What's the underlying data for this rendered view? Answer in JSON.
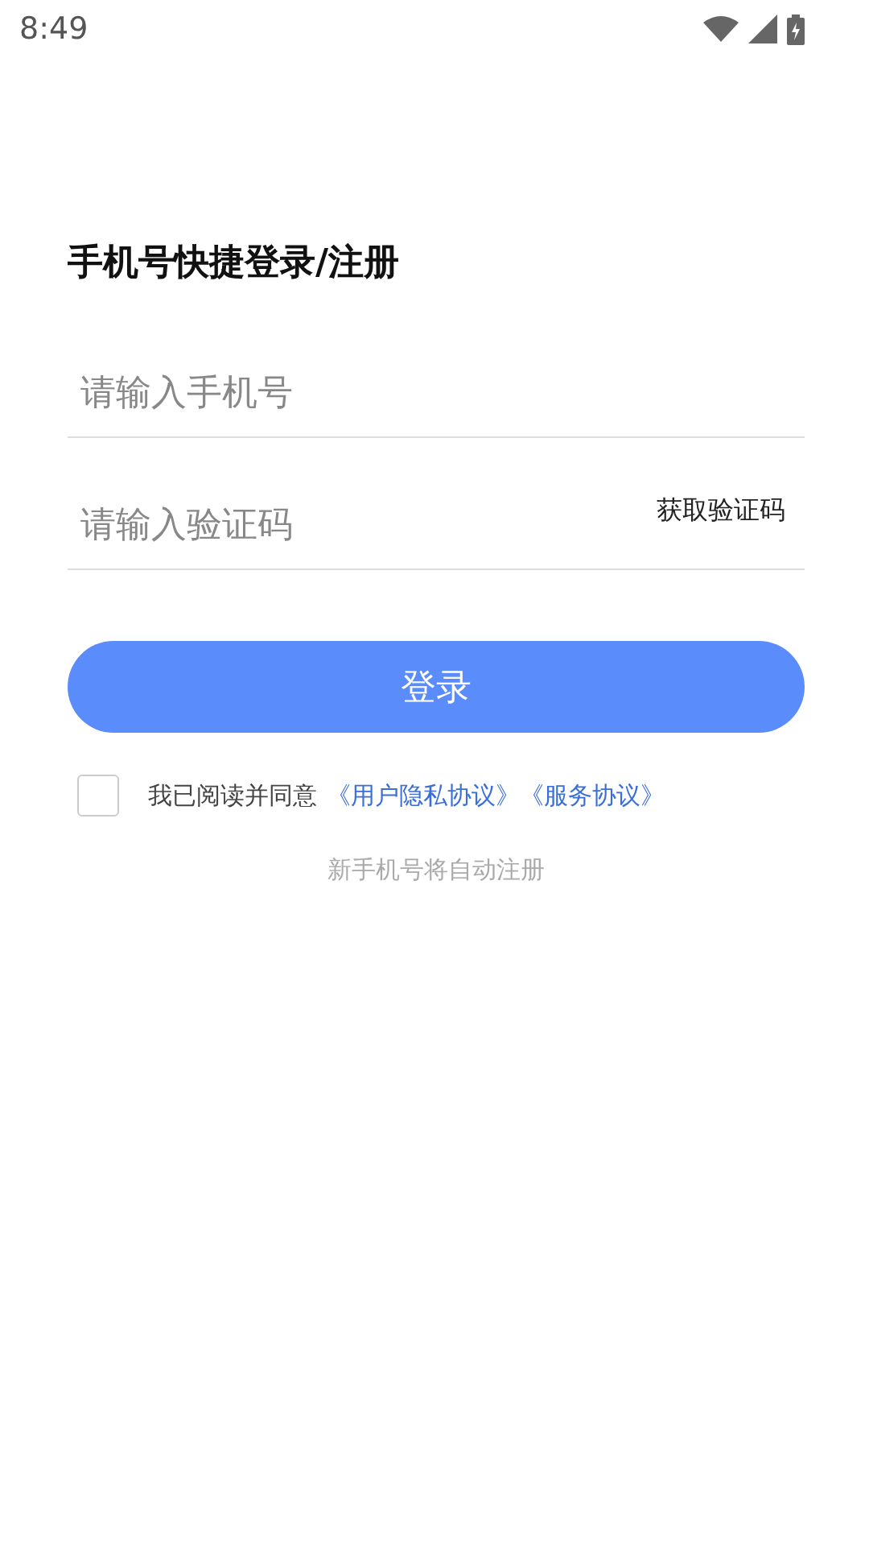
{
  "status_bar": {
    "time": "8:49"
  },
  "title": "手机号快捷登录/注册",
  "phone_field": {
    "placeholder": "请输入手机号"
  },
  "code_field": {
    "placeholder": "请输入验证码",
    "action": "获取验证码"
  },
  "login_button": {
    "label": "登录"
  },
  "agreement": {
    "checked": false,
    "text": "我已阅读并同意",
    "links": [
      "《用户隐私协议》",
      "《服务协议》"
    ]
  },
  "note": "新手机号将自动注册"
}
